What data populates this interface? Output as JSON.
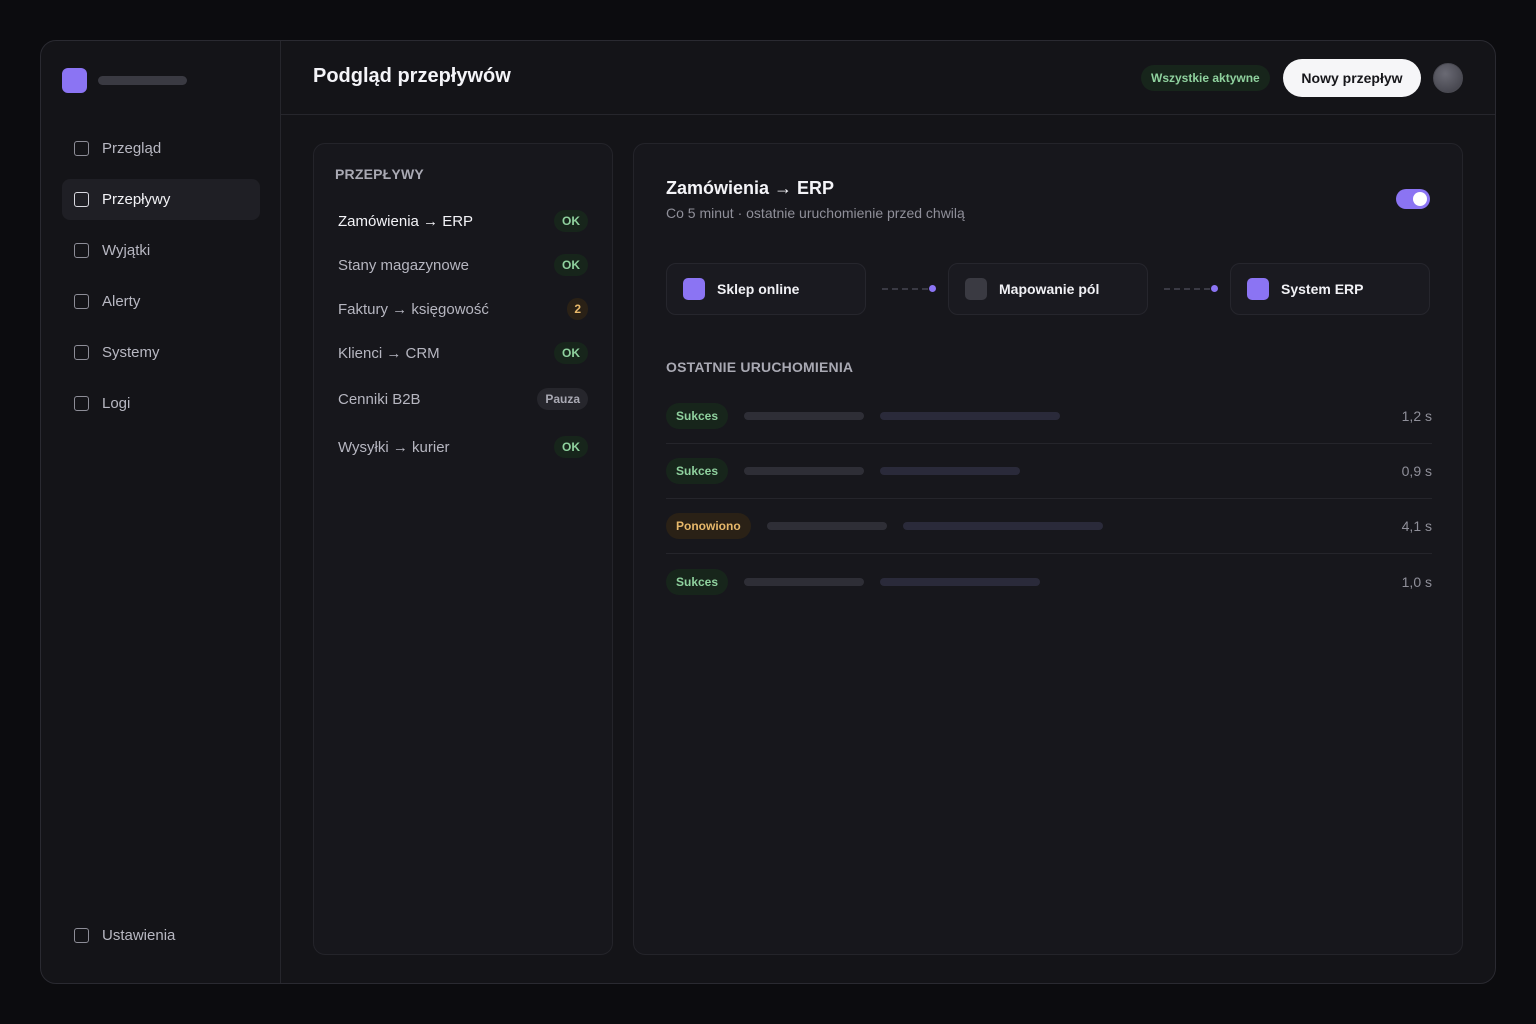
{
  "header": {
    "title": "Podgląd przepływów",
    "status_pill": "Wszystkie aktywne",
    "new_flow_button": "Nowy przepływ"
  },
  "sidebar": {
    "items": [
      {
        "label": "Przegląd",
        "active": false
      },
      {
        "label": "Przepływy",
        "active": true
      },
      {
        "label": "Wyjątki",
        "active": false
      },
      {
        "label": "Alerty",
        "active": false
      },
      {
        "label": "Systemy",
        "active": false
      },
      {
        "label": "Logi",
        "active": false
      }
    ],
    "settings_label": "Ustawienia"
  },
  "flows": {
    "heading": "PRZEPŁYWY",
    "items": [
      {
        "name": "Zamówienia → ERP",
        "badge": "OK",
        "badge_type": "ok",
        "selected": true
      },
      {
        "name": "Stany magazynowe",
        "badge": "OK",
        "badge_type": "ok"
      },
      {
        "name": "Faktury → księgowość",
        "badge": "2",
        "badge_type": "warn"
      },
      {
        "name": "Klienci → CRM",
        "badge": "OK",
        "badge_type": "ok"
      },
      {
        "name": "Cenniki B2B",
        "badge": "Pauza",
        "badge_type": "pause"
      },
      {
        "name": "Wysyłki → kurier",
        "badge": "OK",
        "badge_type": "ok"
      }
    ]
  },
  "detail": {
    "title": "Zamówienia → ERP",
    "subtitle": "Co 5 minut · ostatnie uruchomienie przed chwilą",
    "enabled": true,
    "pipeline": [
      {
        "label": "Sklep online",
        "icon_color": "#8b74f3"
      },
      {
        "label": "Mapowanie pól",
        "icon_color": "#3a3a42"
      },
      {
        "label": "System ERP",
        "icon_color": "#8b74f3"
      }
    ],
    "runs_heading": "OSTATNIE URUCHOMIENIA",
    "runs": [
      {
        "status": "Sukces",
        "type": "success",
        "duration": "1,2 s"
      },
      {
        "status": "Sukces",
        "type": "success",
        "duration": "0,9 s"
      },
      {
        "status": "Ponowiono",
        "type": "retry",
        "duration": "4,1 s"
      },
      {
        "status": "Sukces",
        "type": "success",
        "duration": "1,0 s"
      }
    ]
  },
  "colors": {
    "accent": "#8b74f3",
    "success": "#8fd19e",
    "warning": "#e7b86a"
  }
}
